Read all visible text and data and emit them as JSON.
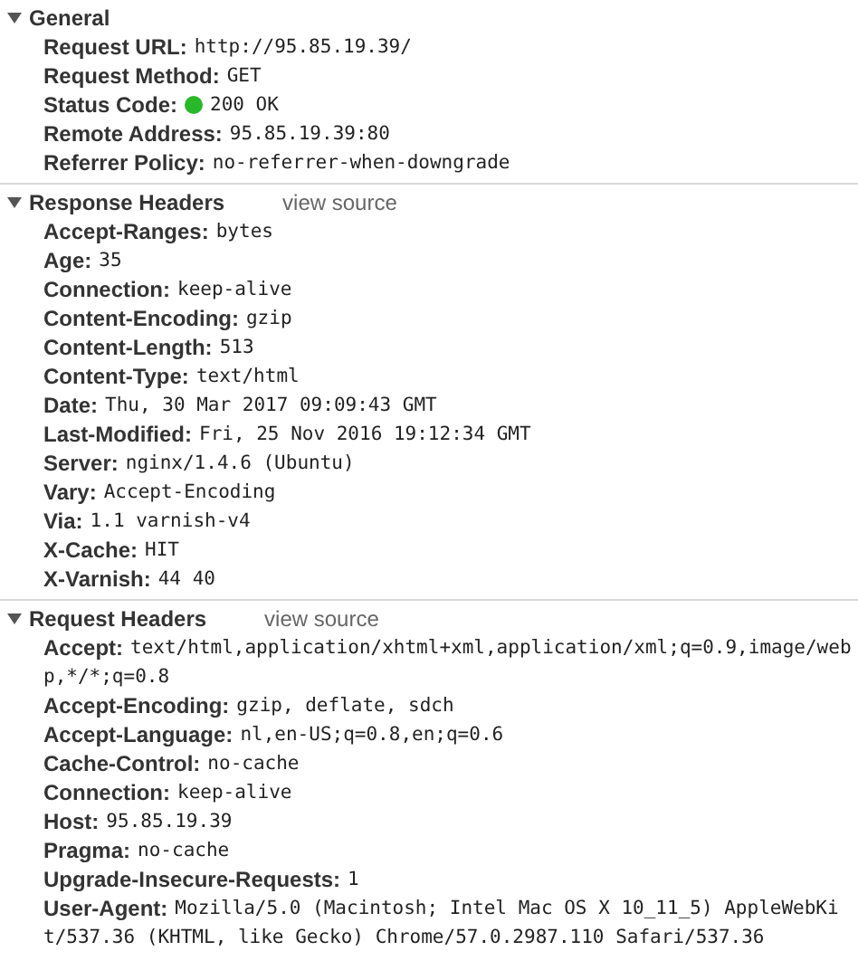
{
  "sections": [
    {
      "title": "General",
      "expanded": true,
      "rows": [
        {
          "name": "Request URL:",
          "value": "http://95.85.19.39/"
        },
        {
          "name": "Request Method:",
          "value": "GET"
        },
        {
          "name": "Status Code:",
          "value": "200 OK",
          "color": "#28b82a"
        },
        {
          "name": "Remote Address:",
          "value": "95.85.19.39:80"
        },
        {
          "name": "Referrer Policy:",
          "value": "no-referrer-when-downgrade"
        }
      ]
    },
    {
      "title": "Response Headers",
      "link": "view source",
      "expanded": true,
      "rows": [
        {
          "name": "Accept-Ranges:",
          "value": "bytes"
        },
        {
          "name": "Age:",
          "value": "35"
        },
        {
          "name": "Connection:",
          "value": "keep-alive"
        },
        {
          "name": "Content-Encoding:",
          "value": "gzip"
        },
        {
          "name": "Content-Length:",
          "value": "513"
        },
        {
          "name": "Content-Type:",
          "value": "text/html"
        },
        {
          "name": "Date:",
          "value": "Thu, 30 Mar 2017 09:09:43 GMT"
        },
        {
          "name": "Last-Modified:",
          "value": "Fri, 25 Nov 2016 19:12:34 GMT"
        },
        {
          "name": "Server:",
          "value": "nginx/1.4.6 (Ubuntu)"
        },
        {
          "name": "Vary:",
          "value": "Accept-Encoding"
        },
        {
          "name": "Via:",
          "value": "1.1 varnish-v4"
        },
        {
          "name": "X-Cache:",
          "value": "HIT"
        },
        {
          "name": "X-Varnish:",
          "value": "44 40"
        }
      ]
    },
    {
      "title": "Request Headers",
      "link": "view source",
      "expanded": true,
      "rows": [
        {
          "name": "Accept:",
          "value": "text/html,application/xhtml+xml,application/xml;q=0.9,image/webp,*/*;q=0.8"
        },
        {
          "name": "Accept-Encoding:",
          "value": "gzip, deflate, sdch"
        },
        {
          "name": "Accept-Language:",
          "value": "nl,en-US;q=0.8,en;q=0.6"
        },
        {
          "name": "Cache-Control:",
          "value": "no-cache"
        },
        {
          "name": "Connection:",
          "value": "keep-alive"
        },
        {
          "name": "Host:",
          "value": "95.85.19.39"
        },
        {
          "name": "Pragma:",
          "value": "no-cache"
        },
        {
          "name": "Upgrade-Insecure-Requests:",
          "value": "1"
        },
        {
          "name": "User-Agent:",
          "value": "Mozilla/5.0 (Macintosh; Intel Mac OS X 10_11_5) AppleWebKit/537.36 (KHTML, like Gecko) Chrome/57.0.2987.110 Safari/537.36"
        }
      ]
    }
  ]
}
